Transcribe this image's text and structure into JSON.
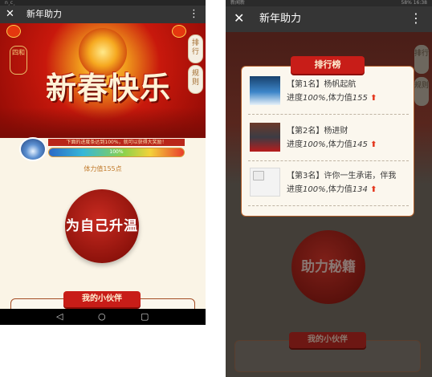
{
  "left": {
    "status_left": "n¸c¸",
    "status_right": "",
    "appbar": {
      "close_glyph": "✕",
      "title": "新年助力",
      "more_glyph": "⋮"
    },
    "banner": {
      "title": "新春快乐",
      "stamp": "四和"
    },
    "side_tabs": [
      {
        "label": "排行"
      },
      {
        "label": "规则"
      }
    ],
    "notice": "下面的进度条达到100%，就可以获得大奖励！",
    "progress": {
      "value_percent": 100,
      "label": "100%"
    },
    "stamina_text": "体力值155点",
    "warm_button": "为自己升温",
    "partners_title": "我的小伙伴",
    "nav": {
      "back": "◁",
      "home": "○",
      "recent": "▢"
    }
  },
  "right": {
    "status_left": "新闻新",
    "status_right": "58%  16:38",
    "appbar": {
      "close_glyph": "✕",
      "title": "新年助力",
      "more_glyph": "⋮"
    },
    "side_tabs": [
      {
        "label": "排行"
      },
      {
        "label": "规则"
      }
    ],
    "ranking": {
      "title": "排行榜",
      "rows": [
        {
          "rank": "【第1名】杨帆起航",
          "progress_prefix": "进度",
          "progress": "100%",
          "stamina_prefix": ",体力值",
          "stamina": "155",
          "arrow": "⬆"
        },
        {
          "rank": "【第2名】杨进财",
          "progress_prefix": "进度",
          "progress": "100%",
          "stamina_prefix": ",体力值",
          "stamina": "145",
          "arrow": "⬆"
        },
        {
          "rank": "【第3名】许你一生承诺，伴我",
          "progress_prefix": "进度",
          "progress": "100%",
          "stamina_prefix": ",体力值",
          "stamina": "134",
          "arrow": "⬆"
        }
      ]
    },
    "boost_button": "助力秘籍",
    "partners_title": "我的小伙伴"
  },
  "colors": {
    "accent_red": "#c81d18",
    "gold": "#c17a2b",
    "arrow_red": "#e4371e"
  }
}
